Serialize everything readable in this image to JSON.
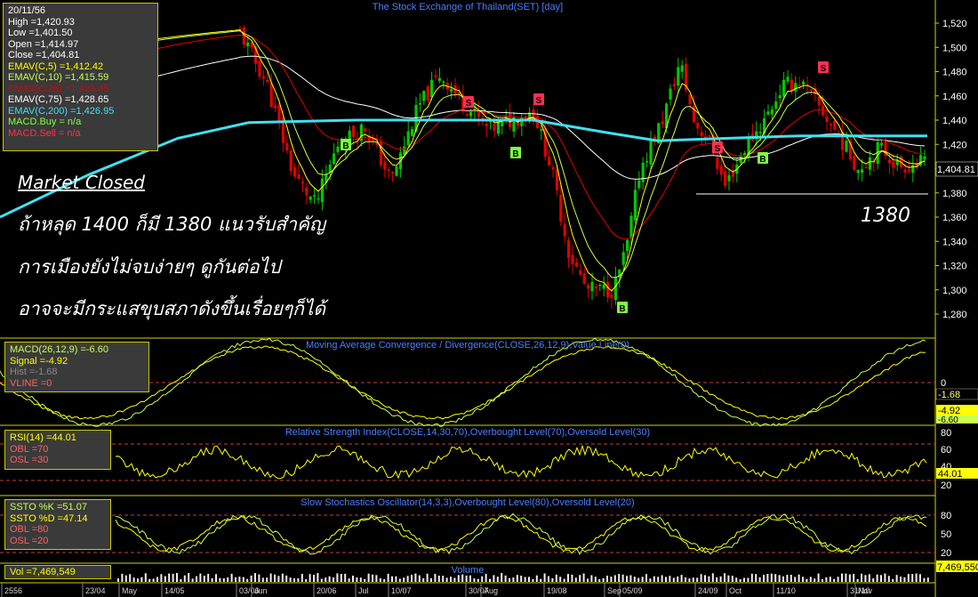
{
  "main_title": "The Stock Exchange of Thailand(SET) [day]",
  "ohlc_box": {
    "date": "20/11/56",
    "high": "High  =1,420.93",
    "low": "Low  =1,401.50",
    "open": "Open  =1,414.97",
    "close": "Close  =1,404.81",
    "ema5": "EMAV(C,5)  =1,412.42",
    "ema10": "EMAV(C,10)  =1,415.59",
    "ema25": "EMAV(C,25)  =1,423.45",
    "ema75": "EMAV(C,75)  =1,428.65",
    "ema200": "EMAV(C,200)  =1,426.95",
    "macd_buy": "MACD.Buy  = n/a",
    "macd_sell": "MACD.Sell  = n/a"
  },
  "notes": {
    "market_closed": "Market Closed",
    "line1": "ถ้าหลุด 1400 ก็มี 1380 แนวรับสำคัญ",
    "line2": "การเมืองยังไม่จบง่ายๆ ดูกันต่อไป",
    "line3": "อาจจะมีกระแสขุบสภาดังขึ้นเรื่อยๆก็ได้",
    "support_label": "1380"
  },
  "price_ticks": [
    "1,520",
    "1,500",
    "1,480",
    "1,460",
    "1,440",
    "1,420",
    "1,400",
    "1,380",
    "1,360",
    "1,340",
    "1,320",
    "1,300",
    "1,280"
  ],
  "last_price_label": "1,404.81",
  "macd_panel": {
    "title": "Moving Average Convergence / Divergence(CLOSE,26,12,9),Value Line(0)",
    "box": {
      "macd": "MACD(26,12,9)  =-6.60",
      "signal": "Signal  =-4.92",
      "hist": "Hist  =-1.68",
      "vline": "VLINE  =0"
    },
    "ticks": [
      "0"
    ],
    "value_labels": [
      "-1.68",
      "-4.92",
      "-6.60"
    ]
  },
  "rsi_panel": {
    "title": "Relative Strength Index(CLOSE,14,30,70),Overbought Level(70),Oversold Level(30)",
    "box": {
      "rsi": "RSI(14)  =44.01",
      "obl": "OBL  =70",
      "osl": "OSL  =30"
    },
    "ticks": [
      "80",
      "60",
      "40",
      "20"
    ],
    "value_label": "44.01"
  },
  "stoch_panel": {
    "title": "Slow Stochastics Oscillator(14,3,3),Overbought Level(80),Oversold Level(20)",
    "box": {
      "k": "SSTO %K  =51.07",
      "d": "SSTO %D  =47.14",
      "obl": "OBL  =80",
      "osl": "OSL  =20"
    },
    "ticks": [
      "80",
      "50",
      "20"
    ]
  },
  "volume_panel": {
    "title": "Volume",
    "box": {
      "vol": "Vol  =7,469,549"
    },
    "value_label": "7,469,550"
  },
  "x_axis": {
    "labels": [
      {
        "text": "2556"
      },
      {
        "text": "23/04"
      },
      {
        "text": "May"
      },
      {
        "text": "14/05"
      },
      {
        "text": "03/06"
      },
      {
        "text": "Jun"
      },
      {
        "text": "20/06"
      },
      {
        "text": "Jul"
      },
      {
        "text": "10/07"
      },
      {
        "text": "30/07"
      },
      {
        "text": "Aug"
      },
      {
        "text": "19/08"
      },
      {
        "text": "Sep"
      },
      {
        "text": "05/09"
      },
      {
        "text": "24/09"
      },
      {
        "text": "Oct"
      },
      {
        "text": "11/10"
      },
      {
        "text": "31/10"
      },
      {
        "text": "Nov"
      }
    ]
  },
  "colors": {
    "background": "#000000",
    "bull": "#00c800",
    "bear": "#e00000",
    "ema5": "#ffff00",
    "ema10": "#c8ff50",
    "ema25": "#e00000",
    "ema75": "#ffffff",
    "ema200": "#40e0f0",
    "grid": "#d2d200",
    "buy_signal": "#80ff40",
    "sell_signal": "#ff3050"
  },
  "chart_data": {
    "type": "candlestick",
    "title": "The Stock Exchange of Thailand(SET) [day]",
    "ylim": [
      1265,
      1530
    ],
    "support_level": 1380,
    "last_close": 1404.81,
    "x_ticks": [
      "23/04",
      "May",
      "14/05",
      "03/06",
      "Jun",
      "20/06",
      "Jul",
      "10/07",
      "30/07",
      "Aug",
      "19/08",
      "Sep",
      "05/09",
      "24/09",
      "Oct",
      "11/10",
      "31/10",
      "Nov"
    ],
    "price_anchor_estimates": [
      {
        "date": "03/06",
        "close": 1515
      },
      {
        "date": "20/06",
        "close": 1360
      },
      {
        "date": "10/07",
        "close": 1480
      },
      {
        "date": "30/07",
        "close": 1440
      },
      {
        "date": "19/08",
        "close": 1300
      },
      {
        "date": "05/09",
        "close": 1470
      },
      {
        "date": "24/09",
        "close": 1390
      },
      {
        "date": "11/10",
        "close": 1470
      },
      {
        "date": "31/10",
        "close": 1410
      },
      {
        "date": "20/11",
        "close": 1404.81
      }
    ],
    "signals": [
      {
        "type": "B",
        "date": "20/06"
      },
      {
        "type": "B",
        "date": "05/07"
      },
      {
        "type": "S",
        "date": "25/07"
      },
      {
        "type": "B",
        "date": "10/08"
      },
      {
        "type": "S",
        "date": "15/08"
      },
      {
        "type": "B",
        "date": "30/08"
      },
      {
        "type": "S",
        "date": "26/09"
      },
      {
        "type": "B",
        "date": "07/10"
      },
      {
        "type": "S",
        "date": "25/10"
      }
    ],
    "indicators": {
      "ema5": 1412.42,
      "ema10": 1415.59,
      "ema25": 1423.45,
      "ema75": 1428.65,
      "ema200": 1426.95,
      "macd": -6.6,
      "signal": -4.92,
      "hist": -1.68,
      "rsi14": 44.01,
      "rsi_ob": 70,
      "rsi_os": 30,
      "stoch_k": 51.07,
      "stoch_d": 47.14,
      "stoch_ob": 80,
      "stoch_os": 20,
      "volume": 7469549
    }
  }
}
